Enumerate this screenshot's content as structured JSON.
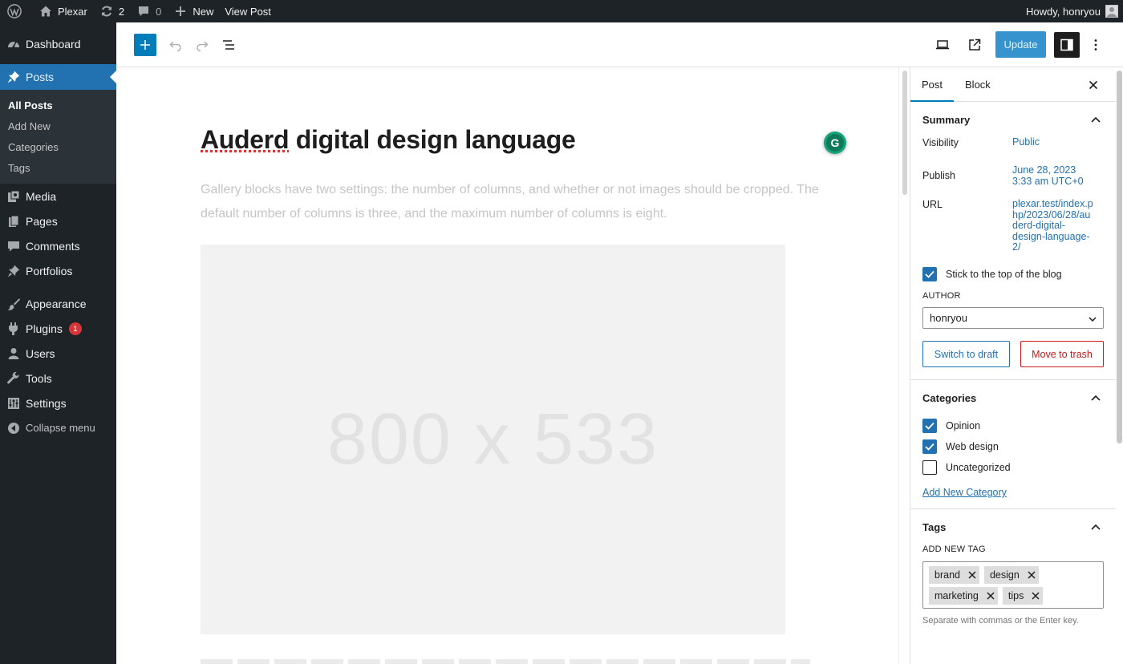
{
  "admin_bar": {
    "site_name": "Plexar",
    "updates_count": "2",
    "comments_count": "0",
    "new_label": "New",
    "view_post_label": "View Post",
    "howdy": "Howdy, honryou"
  },
  "admin_menu": {
    "dashboard": "Dashboard",
    "posts": "Posts",
    "posts_submenu": [
      "All Posts",
      "Add New",
      "Categories",
      "Tags"
    ],
    "media": "Media",
    "pages": "Pages",
    "comments": "Comments",
    "portfolios": "Portfolios",
    "appearance": "Appearance",
    "plugins": "Plugins",
    "plugins_badge": "1",
    "users": "Users",
    "tools": "Tools",
    "settings": "Settings",
    "collapse": "Collapse menu"
  },
  "editor_header": {
    "update_label": "Update"
  },
  "canvas": {
    "title_misspelled": "Auderd",
    "title_rest": " digital design language",
    "excerpt": "Gallery blocks have two settings: the number of columns, and whether or not images should be cropped. The default number of columns is three, and the maximum number of columns is eight.",
    "image_placeholder": "800 x 533",
    "grammarly_letter": "G"
  },
  "sidebar": {
    "tabs": [
      "Post",
      "Block"
    ],
    "summary": {
      "title": "Summary",
      "visibility_label": "Visibility",
      "visibility_value": "Public",
      "publish_label": "Publish",
      "publish_date": "June 28, 2023",
      "publish_time": "3:33 am UTC+0",
      "url_label": "URL",
      "url_lines": [
        "plexar.test/index.p",
        "hp/2023/06/28/au",
        "derd-digital-",
        "design-language-",
        "2/"
      ],
      "sticky_label": "Stick to the top of the blog",
      "sticky_checked": true,
      "author_label": "AUTHOR",
      "author_value": "honryou",
      "switch_draft": "Switch to draft",
      "move_trash": "Move to trash"
    },
    "categories": {
      "title": "Categories",
      "items": [
        {
          "label": "Opinion",
          "checked": true
        },
        {
          "label": "Web design",
          "checked": true
        },
        {
          "label": "Uncategorized",
          "checked": false
        }
      ],
      "add_new": "Add New Category"
    },
    "tags": {
      "title": "Tags",
      "add_label": "ADD NEW TAG",
      "tokens": [
        "brand",
        "design",
        "marketing",
        "tips"
      ],
      "help": "Separate with commas or the Enter key."
    }
  },
  "colors": {
    "admin_dark": "#1d2327",
    "accent": "#2271b1",
    "wp_blue": "#007cba",
    "danger": "#cc1818"
  }
}
